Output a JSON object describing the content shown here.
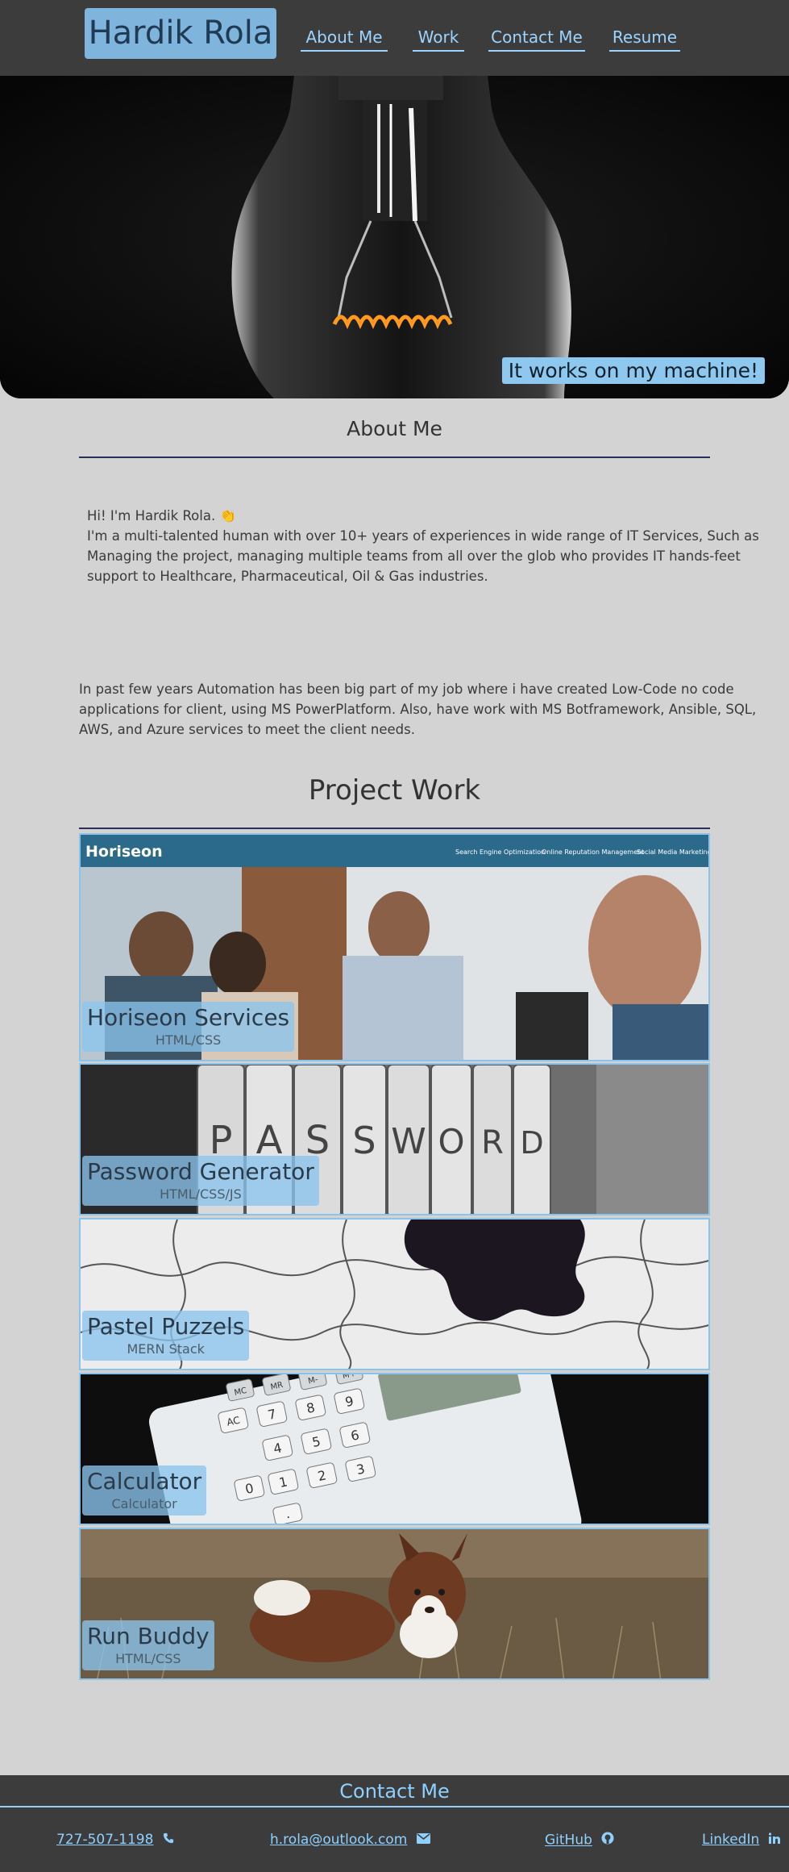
{
  "header": {
    "brand": "Hardik Rola",
    "nav": [
      {
        "label": "About Me"
      },
      {
        "label": "Work"
      },
      {
        "label": "Contact Me"
      },
      {
        "label": "Resume"
      }
    ]
  },
  "hero": {
    "tagline": "It works on my machine!"
  },
  "about": {
    "title": "About Me",
    "intro_line": "Hi! I'm Hardik Rola. 👏",
    "paragraph1_lines": [
      "I'm a multi-talented human with over 10+ years of experiences in wide range of IT Services, Such as",
      "Managing the project, managing multiple teams from all over the glob who provides IT hands-feet",
      "support to Healthcare, Pharmaceutical, Oil & Gas industries."
    ],
    "paragraph2_lines": [
      "In past few years Automation has been big part of my job where i have created Low-Code no code",
      "applications for client, using MS PowerPlatform. Also, have work with MS Botframework, Ansible, SQL,",
      "AWS, and Azure services to meet the client needs."
    ]
  },
  "work": {
    "title": "Project Work",
    "horiseon_bar": {
      "logo": "Horiseon",
      "links": [
        "Search Engine Optimization",
        "Online Reputation Management",
        "Social Media Marketing"
      ]
    },
    "password_tiles": [
      "P",
      "A",
      "S",
      "S",
      "W",
      "O",
      "R",
      "D"
    ],
    "calc_keys": [
      "MC",
      "MR",
      "M-",
      "M+",
      "AC",
      "7",
      "8",
      "9",
      "4",
      "5",
      "6",
      "1",
      "2",
      "3",
      "0",
      "."
    ],
    "projects": [
      {
        "name": "Horiseon Services",
        "tech": "HTML/CSS"
      },
      {
        "name": "Password Generator",
        "tech": "HTML/CSS/JS"
      },
      {
        "name": "Pastel Puzzels",
        "tech": "MERN Stack"
      },
      {
        "name": "Calculator",
        "tech": "Calculator"
      },
      {
        "name": "Run Buddy",
        "tech": "HTML/CSS"
      }
    ]
  },
  "footer": {
    "title": "Contact Me",
    "phone": "727-507-1198",
    "email": "h.rola@outlook.com",
    "github": "GitHub",
    "linkedin": "LinkedIn",
    "accent": "#8fd0ff"
  }
}
